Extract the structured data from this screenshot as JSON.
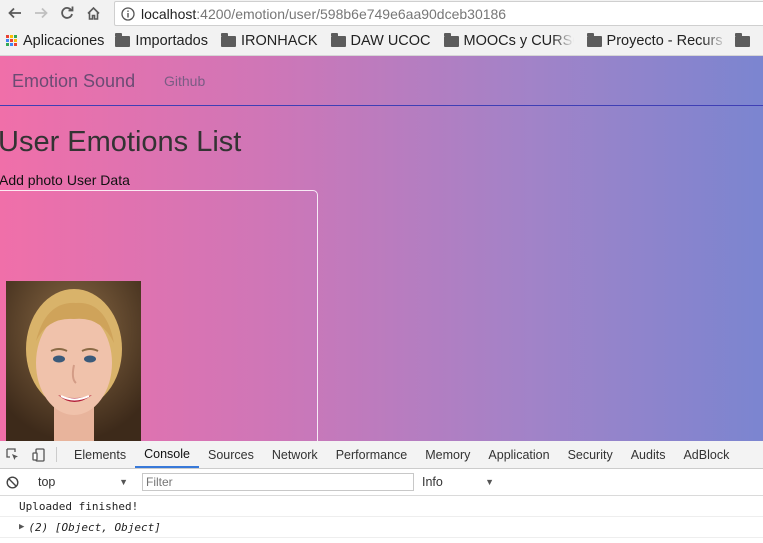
{
  "browser": {
    "url_host": "localhost",
    "url_path": ":4200/emotion/user/598b6e749e6aa90dceb30186",
    "bookmarks": [
      {
        "label": "Aplicaciones",
        "icon": "apps-grid-icon"
      },
      {
        "label": "Importados",
        "icon": "folder-icon"
      },
      {
        "label": "IRONHACK",
        "icon": "folder-icon"
      },
      {
        "label": "DAW UCOC",
        "icon": "folder-icon"
      },
      {
        "label": "MOOCs y CURSOS",
        "icon": "folder-icon"
      },
      {
        "label": "Proyecto - Recurs",
        "icon": "folder-icon"
      }
    ]
  },
  "app": {
    "brand": "Emotion Sound",
    "nav_link": "Github",
    "title": "User Emotions List",
    "links": [
      "Add photo",
      "User Data"
    ],
    "gradient": [
      "#f06fa9",
      "#7b85d0"
    ]
  },
  "devtools": {
    "tabs": [
      "Elements",
      "Console",
      "Sources",
      "Network",
      "Performance",
      "Memory",
      "Application",
      "Security",
      "Audits",
      "AdBlock"
    ],
    "active_tab": "Console",
    "context": "top",
    "filter_placeholder": "Filter",
    "level": "Info",
    "logs": [
      "Uploaded finished!",
      "(2) [Object, Object]"
    ],
    "accent": "#3879d9"
  }
}
